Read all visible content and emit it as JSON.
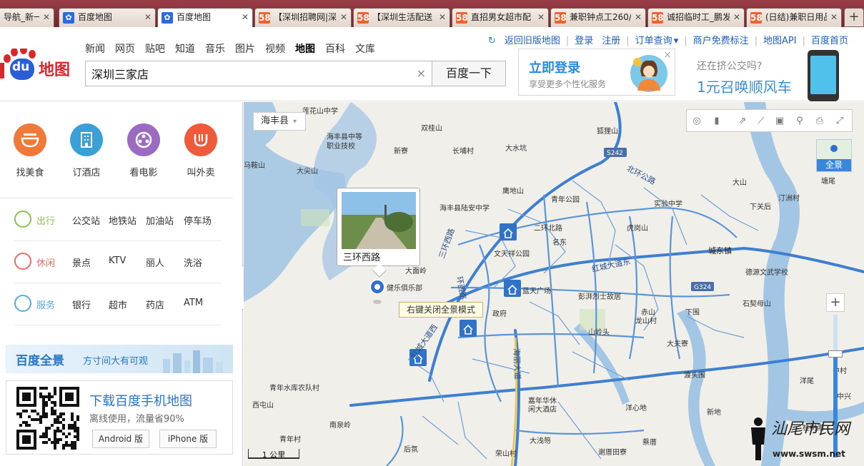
{
  "tabs": [
    {
      "label": "导航_新一代",
      "icon": "none",
      "active": false
    },
    {
      "label": "百度地图",
      "icon": "baidu",
      "active": false
    },
    {
      "label": "百度地图",
      "icon": "baidu",
      "active": true
    },
    {
      "label": "【深圳招聘网|深",
      "icon": "58",
      "active": false
    },
    {
      "label": "【深圳生活配送",
      "icon": "58",
      "active": false
    },
    {
      "label": "直招男女超市配",
      "icon": "58",
      "active": false
    },
    {
      "label": "兼职钟点工260/",
      "icon": "58",
      "active": false
    },
    {
      "label": "诚招临时工_鹏发",
      "icon": "58",
      "active": false
    },
    {
      "label": "(日结)兼职日用品",
      "icon": "58",
      "active": false
    }
  ],
  "new_tab": "+",
  "header": {
    "logo_text": "地图",
    "logo_du": "du",
    "nav": [
      "新闻",
      "网页",
      "贴吧",
      "知道",
      "音乐",
      "图片",
      "视频",
      "地图",
      "百科",
      "文库"
    ],
    "search_value": "深圳三家店",
    "search_button": "百度一下",
    "clear": "×",
    "top_links": [
      "返回旧版地图",
      "登录",
      "注册",
      "订单查询",
      "商户免费标注",
      "地图API",
      "百度首页"
    ],
    "login_card": {
      "title": "立即登录",
      "subtitle": "享受更多个性化服务",
      "close": "×"
    },
    "promo": {
      "line1": "还在挤公交吗?",
      "line2": "1元召唤顺风车"
    }
  },
  "left": {
    "categories": [
      {
        "label": "找美食",
        "color": "#f0793a"
      },
      {
        "label": "订酒店",
        "color": "#3aa0d8"
      },
      {
        "label": "看电影",
        "color": "#9a6bc0"
      },
      {
        "label": "叫外卖",
        "color": "#ee5a3a"
      }
    ],
    "rows": [
      {
        "label": "出行",
        "color": "#8cc152",
        "items": [
          "公交站",
          "地铁站",
          "加油站",
          "停车场"
        ]
      },
      {
        "label": "休闲",
        "color": "#ec6b6b",
        "items": [
          "景点",
          "KTV",
          "丽人",
          "洗浴"
        ]
      },
      {
        "label": "服务",
        "color": "#5aa9d8",
        "items": [
          "银行",
          "超市",
          "药店",
          "ATM"
        ]
      }
    ],
    "pano_banner": {
      "title": "百度全景",
      "sub": "方寸间大有可观"
    },
    "download": {
      "title": "下载百度手机地图",
      "sub": "离线使用，流量省90%",
      "android": "Android 版",
      "iphone": "iPhone 版"
    }
  },
  "map": {
    "city": "海丰县",
    "pano_label": "全景",
    "popup_caption": "三环西路",
    "tooltip": "右键关闭全景模式",
    "scale": "1 公里",
    "zoom_in": "+",
    "labels": {
      "l1": "莲花山中学",
      "l2": "海丰县中等",
      "l3": "职业技校",
      "l4": "双桂山",
      "l5": "长埔村",
      "l6": "大水坑",
      "l7": "狐狸山",
      "l8": "新寮",
      "l9": "马鞍山",
      "l10": "大尖山",
      "l11": "鹰地山",
      "l12": "青年公园",
      "l13": "实验中学",
      "l14": "海丰县陆安中学",
      "l15": "二环北路",
      "l16": "虎岗山",
      "l17": "名东",
      "l18": "文天祥公园",
      "l19": "城东镇",
      "l20": "红城大道东",
      "l21": "大面岭",
      "l22": "健乐俱乐部",
      "l23": "蓝天广场",
      "l24": "彭湃烈士故居",
      "l25": "德源文武学校",
      "l26": "石契母山",
      "l27": "下围",
      "l28": "赤山",
      "l29": "龙山村",
      "l30": "政府",
      "l31": "山岭头",
      "l32": "大夫寮",
      "l33": "渡头围",
      "l34": "青年水库农队村",
      "l35": "西屯山",
      "l36": "南泉岭",
      "l37": "嘉年华休",
      "l38": "闲大酒店",
      "l39": "洋心地",
      "l40": "新地",
      "l41": "青年村",
      "l42": "后氛",
      "l43": "大浅笏",
      "l44": "荣山村",
      "l45": "谢厝田寮",
      "l46": "蔡厝",
      "l47": "大山",
      "l48": "汀洲村",
      "l49": "下关后",
      "l50": "塘尾",
      "l51": "洋尾",
      "l52": "中村",
      "l53": "中兴",
      "l54": "桂树港",
      "l55": "海丰县"
    },
    "road_labels": {
      "r1": "北环公路",
      "r2": "三环西路",
      "r3": "环西路",
      "r4": "红城大道西",
      "r5": "海丽大道",
      "r6": "S242",
      "r7": "G324"
    }
  },
  "watermark": {
    "line1": "汕尾市民网",
    "line2": "www.swsm.net"
  }
}
